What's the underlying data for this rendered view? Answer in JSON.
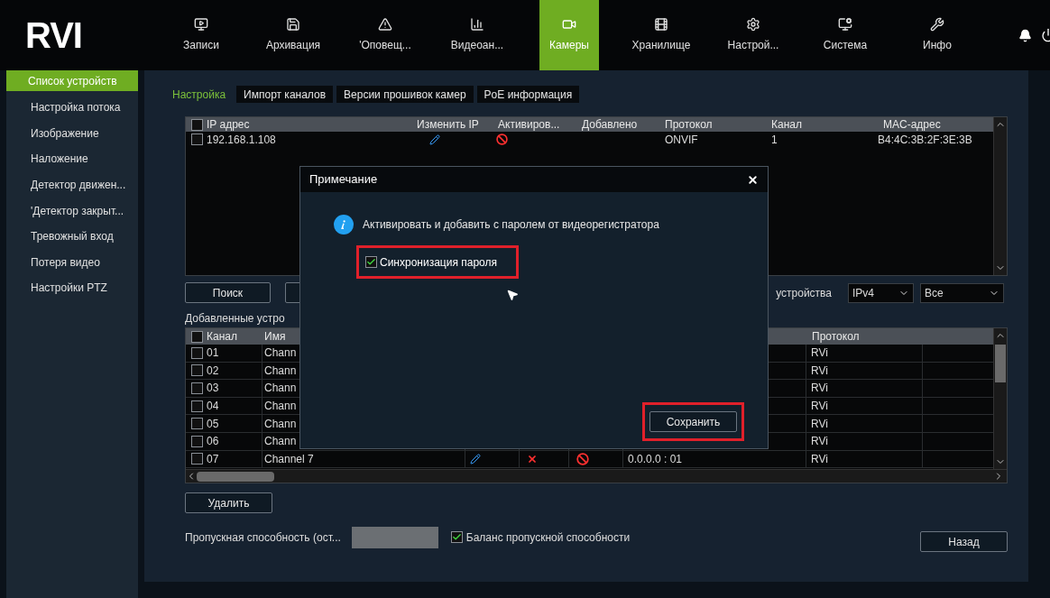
{
  "logo": "RVI",
  "nav": [
    {
      "label": "Записи",
      "selected": false
    },
    {
      "label": "Архивация",
      "selected": false
    },
    {
      "label": "'Оповещ...",
      "selected": false
    },
    {
      "label": "Видеоан...",
      "selected": false
    },
    {
      "label": "Камеры",
      "selected": true
    },
    {
      "label": "Хранилище",
      "selected": false
    },
    {
      "label": "Настрой...",
      "selected": false
    },
    {
      "label": "Система",
      "selected": false
    },
    {
      "label": "Инфо",
      "selected": false
    }
  ],
  "sidebar": {
    "items": [
      {
        "label": "Список устройств",
        "selected": true
      },
      {
        "label": "Настройка потока",
        "selected": false
      },
      {
        "label": "Изображение",
        "selected": false
      },
      {
        "label": "Наложение",
        "selected": false
      },
      {
        "label": "Детектор движен...",
        "selected": false
      },
      {
        "label": "'Детектор закрыт...",
        "selected": false
      },
      {
        "label": "Тревожный вход",
        "selected": false
      },
      {
        "label": "Потеря видео",
        "selected": false
      },
      {
        "label": "Настройки PTZ",
        "selected": false
      }
    ]
  },
  "tabs": [
    {
      "label": "Настройка",
      "selected": true
    },
    {
      "label": "Импорт каналов",
      "selected": false
    },
    {
      "label": "Версии прошивок камер",
      "selected": false
    },
    {
      "label": "PoE информация",
      "selected": false
    }
  ],
  "device_table": {
    "header_checked": false,
    "columns": [
      "IP адрес",
      "Изменить IP",
      "Активиров...",
      "Добавлено",
      "Протокол",
      "Канал",
      "MAC-адрес"
    ],
    "rows": [
      {
        "checked": false,
        "ip": "192.168.1.108",
        "protocol": "ONVIF",
        "channel": "1",
        "mac": "B4:4C:3B:2F:3E:3B"
      }
    ]
  },
  "search_button": "Поиск",
  "device_type_label": "устройства",
  "selects": [
    "IPv4",
    "Все"
  ],
  "added_devices_label": "Добавленные устро",
  "channel_table": {
    "header_checked": false,
    "columns": {
      "channel": "Канал",
      "name": "Имя",
      "protocol": "Протокол"
    },
    "rows": [
      {
        "checked": false,
        "channel": "01",
        "name": "Chann",
        "protocol": "RVi"
      },
      {
        "checked": false,
        "channel": "02",
        "name": "Chann",
        "protocol": "RVi"
      },
      {
        "checked": false,
        "channel": "03",
        "name": "Chann",
        "protocol": "RVi"
      },
      {
        "checked": false,
        "channel": "04",
        "name": "Chann",
        "protocol": "RVi"
      },
      {
        "checked": false,
        "channel": "05",
        "name": "Chann",
        "protocol": "RVi"
      },
      {
        "checked": false,
        "channel": "06",
        "name": "Chann",
        "protocol": "RVi"
      },
      {
        "checked": false,
        "channel": "07",
        "name": "Channel 7",
        "address": "0.0.0.0 : 01",
        "protocol": "RVi"
      }
    ]
  },
  "delete_button": "Удалить",
  "bandwidth_label": "Пропускная способность (ост...",
  "balance": {
    "label": "Баланс пропускной способности",
    "checked": true
  },
  "back_button": "Назад",
  "dialog": {
    "title": "Примечание",
    "message": "Активировать и добавить с паролем от видеорегистратора",
    "sync": {
      "label": "Синхронизация пароля",
      "checked": true
    },
    "save_button": "Сохранить"
  }
}
